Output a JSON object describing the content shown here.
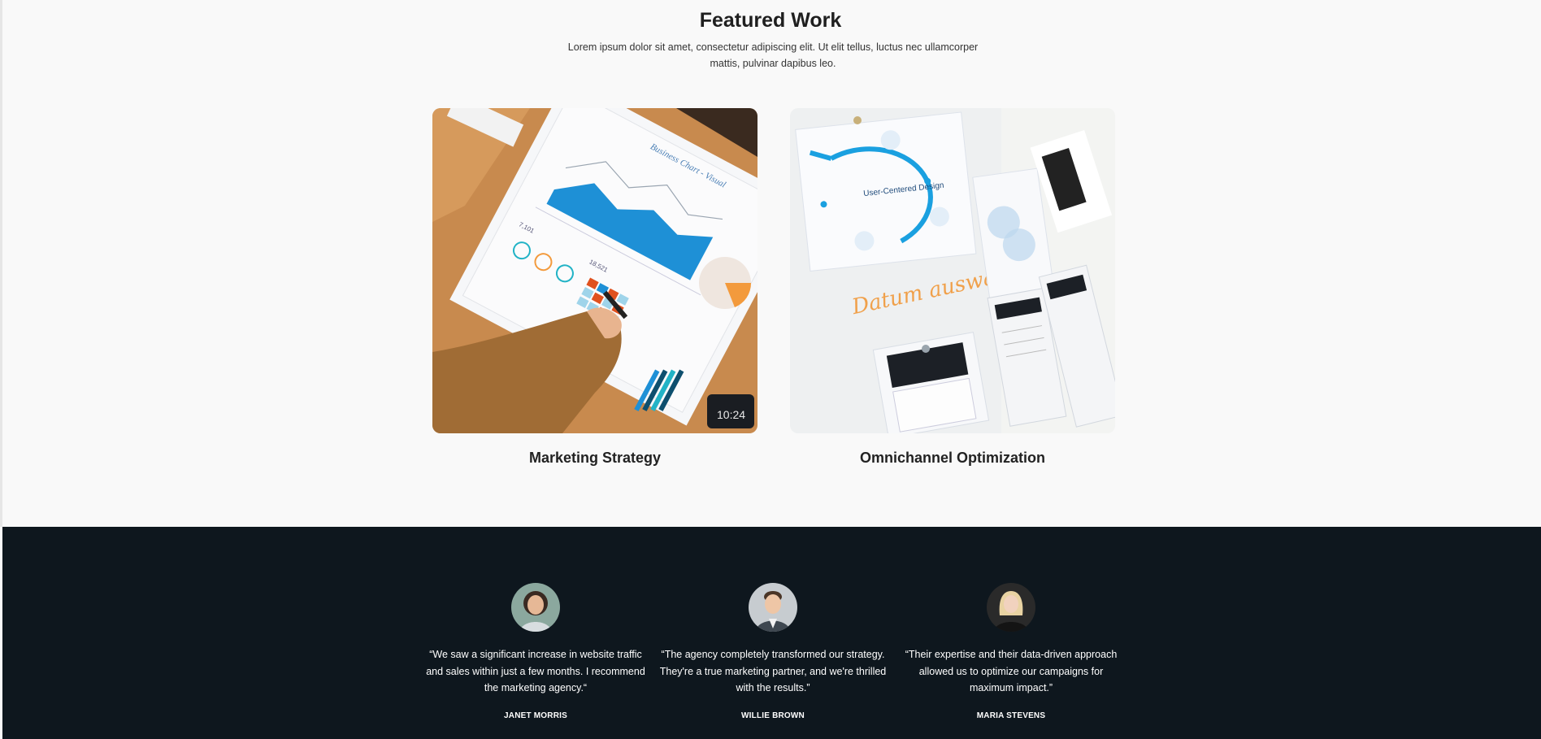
{
  "featured": {
    "title": "Featured Work",
    "intro": "Lorem ipsum dolor sit amet, consectetur adipiscing elit. Ut elit tellus, luctus nec ullamcorper mattis, pulvinar dapibus leo.",
    "cards": [
      {
        "title": "Marketing Strategy",
        "image": "business-chart-photo",
        "image_text": {
          "heading": "Business Chart - Visual",
          "value_1": "7,101",
          "value_2": "18,521",
          "clock": "10:24"
        }
      },
      {
        "title": "Omnichannel Optimization",
        "image": "ux-design-whiteboard-photo",
        "image_text": {
          "cycle_title": "User-Centered Design",
          "handwriting": "Datum auswählen"
        }
      }
    ]
  },
  "testimonials": [
    {
      "quote": "“We saw a significant increase in website traffic and sales within just a few months. I recommend the marketing agency.“",
      "name": "JANET MORRIS",
      "avatar": "avatar-janet"
    },
    {
      "quote": "“The agency completely transformed our strategy. They're a true marketing partner, and we're thrilled with the results.”",
      "name": "WILLIE BROWN",
      "avatar": "avatar-willie"
    },
    {
      "quote": "“Their expertise and their data-driven approach allowed us to optimize our campaigns for maximum impact.”",
      "name": "MARIA STEVENS",
      "avatar": "avatar-maria"
    }
  ],
  "colors": {
    "page_bg": "#f9f9f9",
    "testimonial_bg": "#0e171e",
    "heading": "#1f1f1f",
    "chart_blue": "#1e90d6",
    "accent_orange": "#f39a3c"
  }
}
